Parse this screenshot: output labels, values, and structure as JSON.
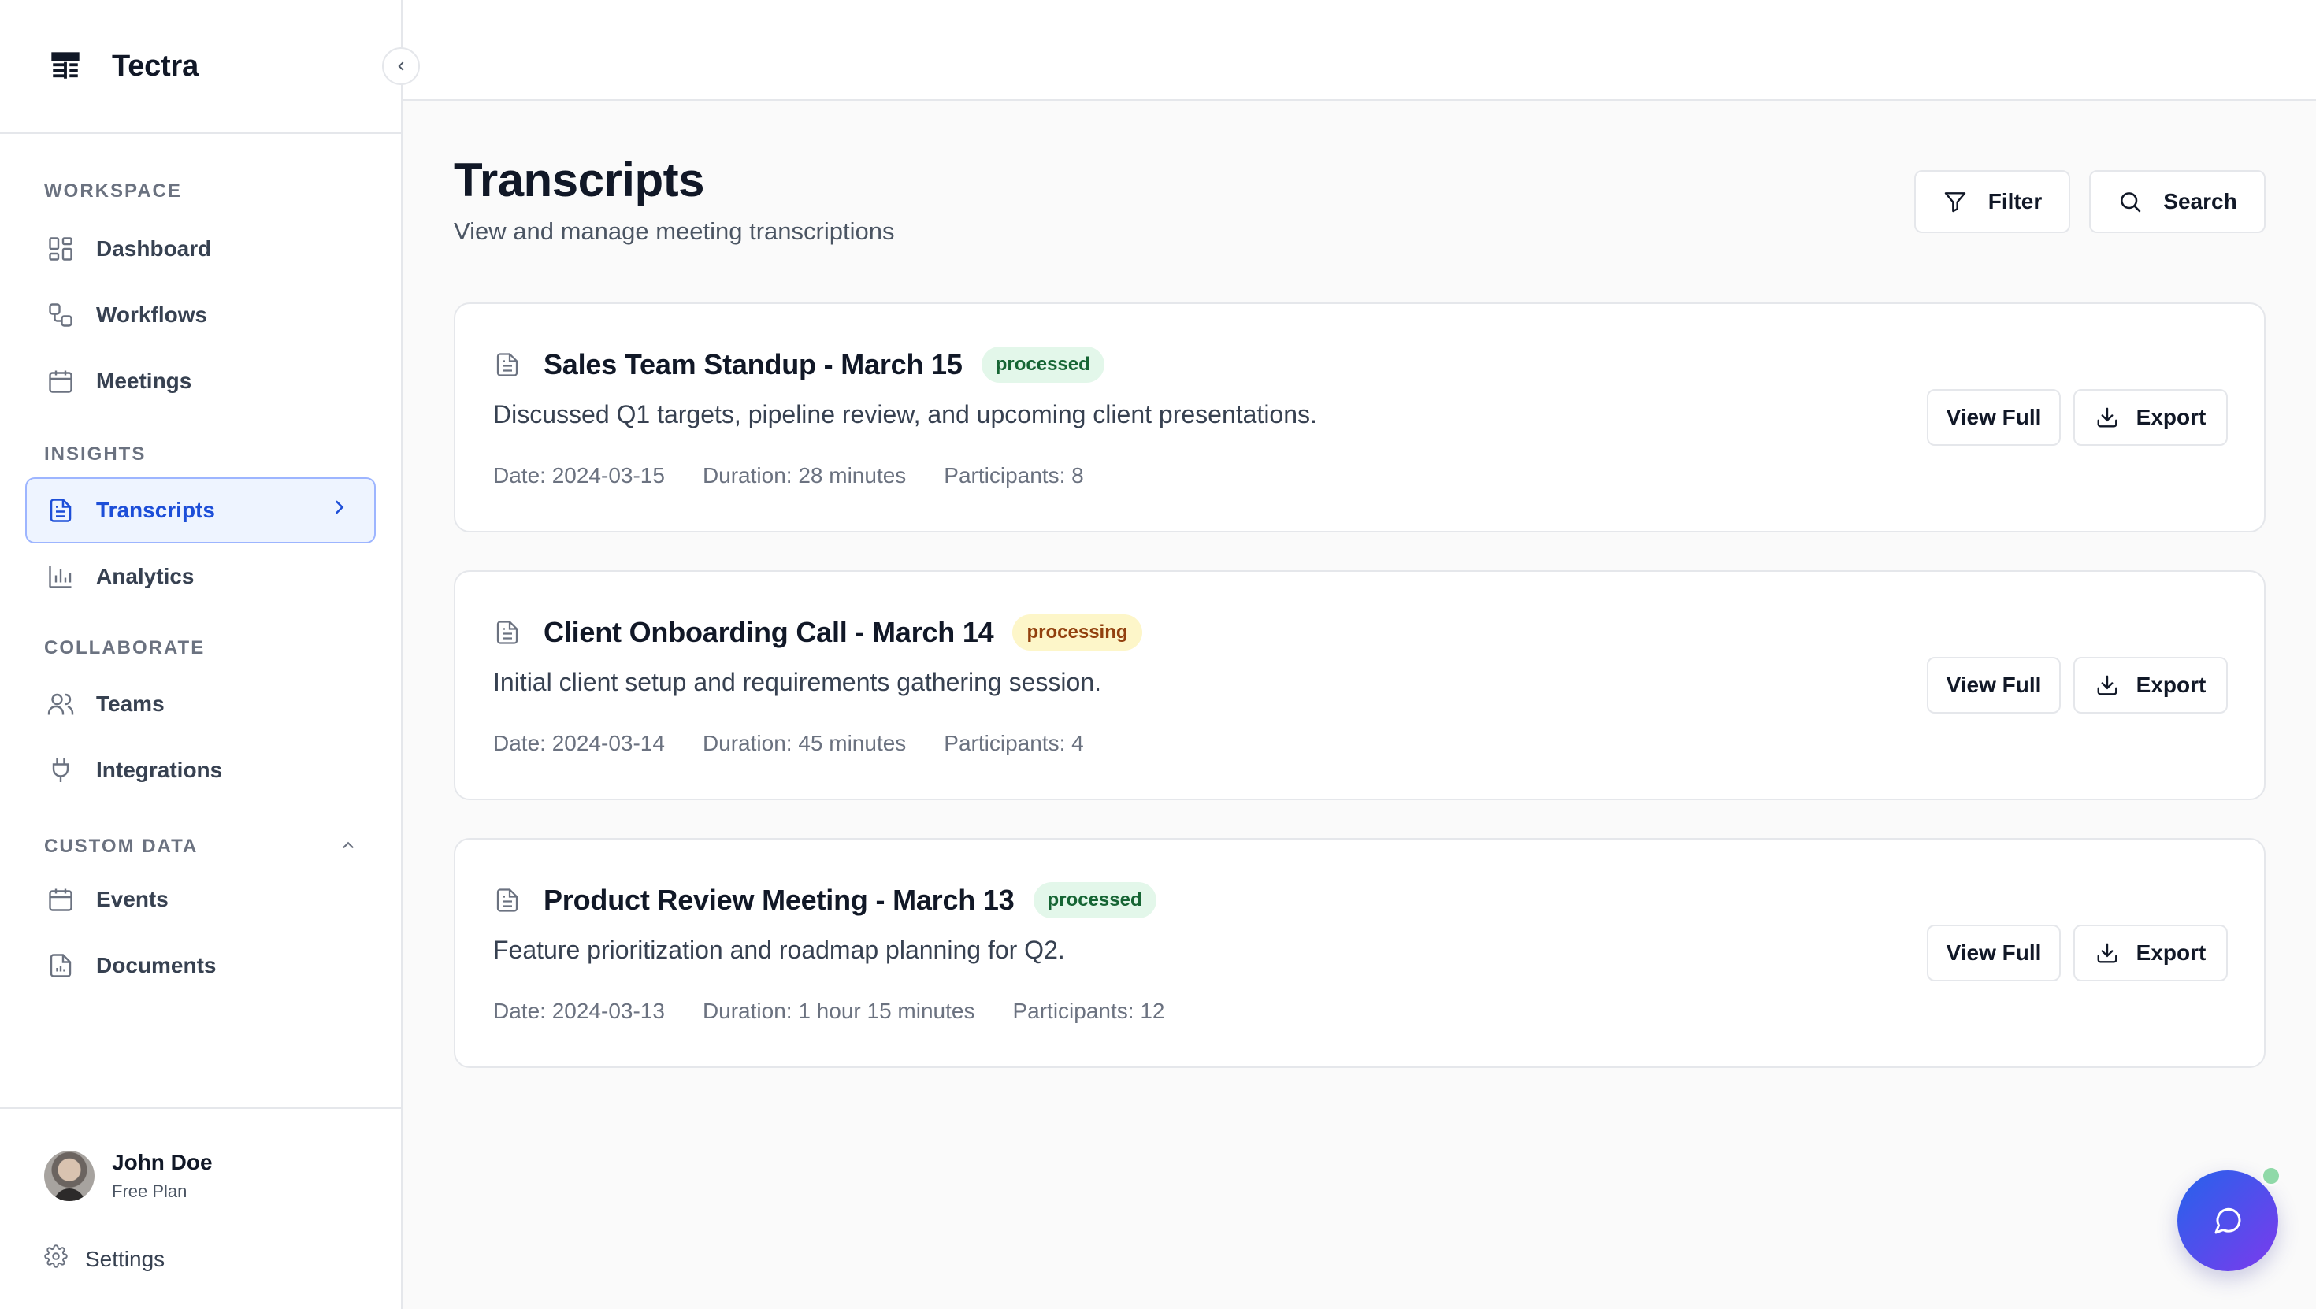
{
  "app": {
    "name": "Tectra"
  },
  "sidebar": {
    "sections": [
      {
        "title": "WORKSPACE",
        "items": [
          {
            "label": "Dashboard",
            "icon": "dashboard-icon"
          },
          {
            "label": "Workflows",
            "icon": "workflow-icon"
          },
          {
            "label": "Meetings",
            "icon": "calendar-icon"
          }
        ]
      },
      {
        "title": "INSIGHTS",
        "items": [
          {
            "label": "Transcripts",
            "icon": "document-icon",
            "active": true
          },
          {
            "label": "Analytics",
            "icon": "bar-chart-icon"
          }
        ]
      },
      {
        "title": "COLLABORATE",
        "items": [
          {
            "label": "Teams",
            "icon": "users-icon"
          },
          {
            "label": "Integrations",
            "icon": "plug-icon"
          }
        ]
      },
      {
        "title": "CUSTOM DATA",
        "collapsible": true,
        "items": [
          {
            "label": "Events",
            "icon": "calendar-icon"
          },
          {
            "label": "Documents",
            "icon": "file-chart-icon"
          }
        ]
      }
    ],
    "user": {
      "name": "John Doe",
      "plan": "Free Plan"
    },
    "settings_label": "Settings"
  },
  "page": {
    "title": "Transcripts",
    "subtitle": "View and manage meeting transcriptions",
    "filter_label": "Filter",
    "search_label": "Search"
  },
  "transcripts": [
    {
      "title": "Sales Team Standup - March 15",
      "status": "processed",
      "description": "Discussed Q1 targets, pipeline review, and upcoming client presentations.",
      "date": "Date: 2024-03-15",
      "duration": "Duration: 28 minutes",
      "participants": "Participants: 8",
      "view_label": "View Full",
      "export_label": "Export"
    },
    {
      "title": "Client Onboarding Call - March 14",
      "status": "processing",
      "description": "Initial client setup and requirements gathering session.",
      "date": "Date: 2024-03-14",
      "duration": "Duration: 45 minutes",
      "participants": "Participants: 4",
      "view_label": "View Full",
      "export_label": "Export"
    },
    {
      "title": "Product Review Meeting - March 13",
      "status": "processed",
      "description": "Feature prioritization and roadmap planning for Q2.",
      "date": "Date: 2024-03-13",
      "duration": "Duration: 1 hour 15 minutes",
      "participants": "Participants: 12",
      "view_label": "View Full",
      "export_label": "Export"
    }
  ],
  "colors": {
    "accent": "#1d4ed8",
    "active_bg": "#eef4ff",
    "processed_bg": "#e3f7ea",
    "processing_bg": "#fdf6c9",
    "fab_start": "#2563eb",
    "fab_end": "#7c3aed"
  }
}
